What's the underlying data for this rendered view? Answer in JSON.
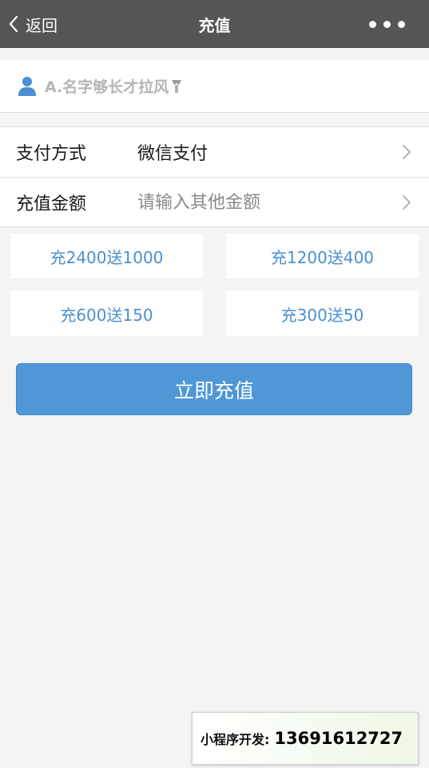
{
  "navbar": {
    "back_label": "返回",
    "title": "充值",
    "back_icon": "chevron-left-icon",
    "more_icon": "more-dots-icon"
  },
  "user": {
    "name": "A.名字够长才拉风",
    "avatar_icon": "user-icon",
    "badge_icon": "badge-icon"
  },
  "form": {
    "pay_method_label": "支付方式",
    "pay_method_value": "微信支付",
    "amount_label": "充值金额",
    "amount_placeholder": "请输入其他金额",
    "amount_value": ""
  },
  "options": [
    {
      "label": "充2400送1000"
    },
    {
      "label": "充1200送400"
    },
    {
      "label": "充600送150"
    },
    {
      "label": "充300送50"
    }
  ],
  "submit_label": "立即充值",
  "promo": {
    "label": "小程序开发:",
    "phone": "13691612727"
  },
  "colors": {
    "navbar_bg": "#555456",
    "accent_blue": "#4f97d6",
    "option_text": "#4a8fce",
    "page_bg": "#f4f4f4"
  }
}
